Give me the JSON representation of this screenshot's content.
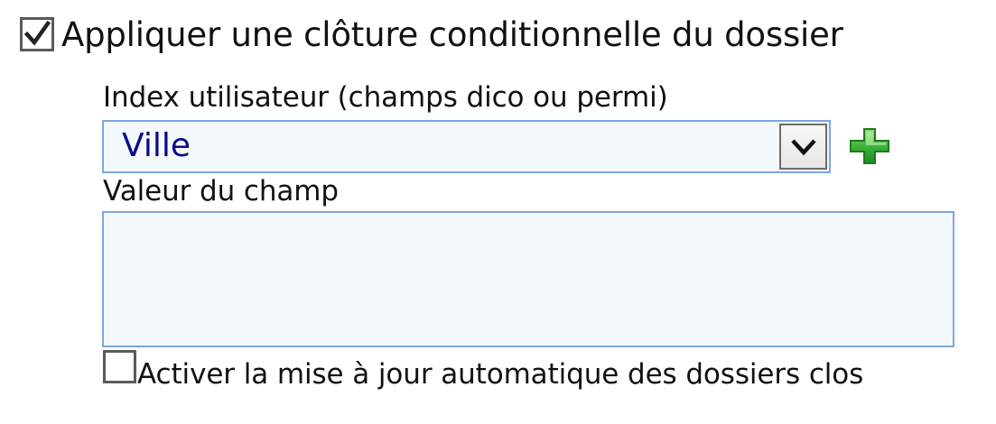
{
  "conditional_closure": {
    "label": "Appliquer une clôture conditionnelle du dossier",
    "checked": true
  },
  "index_field": {
    "label": "Index utilisateur (champs dico ou permi)",
    "selected_value": "Ville",
    "add_icon": "plus-icon"
  },
  "value_field": {
    "label": "Valeur du champ",
    "value": ""
  },
  "auto_update": {
    "label": "Activer la mise à jour automatique des dossiers clos",
    "checked": false
  },
  "colors": {
    "field_border": "#7ea6e0",
    "field_background": "#f4f9fd",
    "select_text": "#0a0a8a",
    "add_icon_green": "#3cb43c"
  }
}
